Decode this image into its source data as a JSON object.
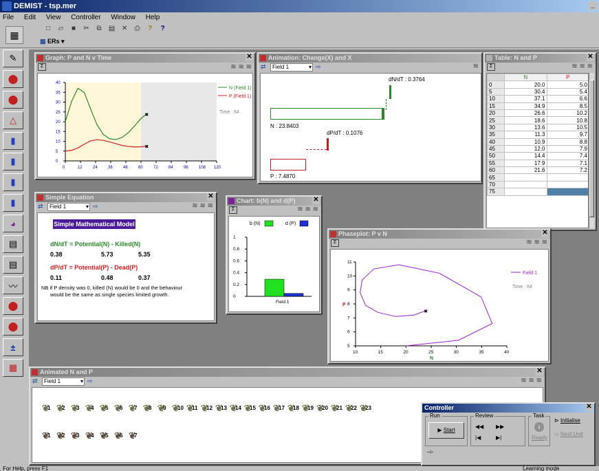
{
  "app": {
    "title": "DEMIST - tsp.mer",
    "menu": [
      "File",
      "Edit",
      "View",
      "Controller",
      "Window",
      "Help"
    ],
    "ers_label": "ERs",
    "status_left": "For Help, press F1",
    "status_right": "Learning mode"
  },
  "graph": {
    "title": "Graph: P and N v Time",
    "legend": [
      "N (Field 1)",
      "P (Field 1)"
    ],
    "time_label": "Time : 64",
    "xticks": [
      "0",
      "12",
      "24",
      "36",
      "48",
      "60",
      "72",
      "84",
      "96",
      "108",
      "120"
    ],
    "yticks": [
      "0",
      "5",
      "10",
      "15",
      "20",
      "25",
      "30",
      "35",
      "40"
    ]
  },
  "animation": {
    "title": "Animation: Change(X) and X",
    "field": "Field 1",
    "dndt": "dN/dT : 0.3764",
    "n": "N : 23.8403",
    "dpdt": "dP/dT : 0.1076",
    "p": "P : 7.4870"
  },
  "table": {
    "title": "Table: N and P",
    "headers": [
      "N",
      "P"
    ],
    "rows": [
      [
        "0",
        "20.0",
        "5.0"
      ],
      [
        "5",
        "30.4",
        "5.4"
      ],
      [
        "10",
        "37.1",
        "6.6"
      ],
      [
        "15",
        "34.9",
        "8.5"
      ],
      [
        "20",
        "26.6",
        "10.2"
      ],
      [
        "25",
        "18.6",
        "10.8"
      ],
      [
        "30",
        "13.6",
        "10.5"
      ],
      [
        "35",
        "11.3",
        "9.7"
      ],
      [
        "40",
        "10.9",
        "8.8"
      ],
      [
        "45",
        "12.0",
        "7.9"
      ],
      [
        "50",
        "14.4",
        "7.4"
      ],
      [
        "55",
        "17.9",
        "7.1"
      ],
      [
        "60",
        "21.6",
        "7.2"
      ],
      [
        "65",
        "",
        ""
      ],
      [
        "70",
        "",
        ""
      ],
      [
        "75",
        "",
        ""
      ]
    ]
  },
  "equation": {
    "title": "Simple Equation",
    "field": "Field 1",
    "model_title": "Simple Mathematical Model",
    "eq1": "dN/dT  =  Potential(N) - Killed(N)",
    "eq1_vals": [
      "0.38",
      "5.73",
      "5.35"
    ],
    "eq2": "dP/dT  =  Potential(P) - Dead(P)",
    "eq2_vals": [
      "0.11",
      "0.48",
      "0.37"
    ],
    "note1": "NB if P density was 0, killed (N) would be 0 and the behaviour",
    "note2": "would be the same as single species limited growth."
  },
  "barchart": {
    "title": "Chart: b(N) and d(P)",
    "legend": [
      "b (N)",
      "d (P)"
    ],
    "yticks": [
      "0",
      "0.2",
      "0.4",
      "0.6",
      "0.8",
      "1"
    ],
    "category": "Field 1"
  },
  "phaseplot": {
    "title": "Phaseplot: P v N",
    "legend": "Field 1",
    "time_label": "Time : 64",
    "xticks": [
      "10",
      "15",
      "20",
      "25",
      "30",
      "35",
      "40"
    ],
    "yticks": [
      "5",
      "6",
      "7",
      "8",
      "9",
      "10",
      "11"
    ],
    "xlabel": "N",
    "ylabel": "P"
  },
  "animated": {
    "title": "Animated N and P",
    "field": "Field 1",
    "row1": [
      "1",
      "2",
      "3",
      "4",
      "5",
      "6",
      "7",
      "8",
      "9",
      "10",
      "11",
      "12",
      "13",
      "14",
      "15",
      "16",
      "17",
      "18",
      "19",
      "20",
      "21",
      "22",
      "23"
    ],
    "row2": [
      "1",
      "2",
      "3",
      "4",
      "5",
      "6",
      "7"
    ]
  },
  "controller": {
    "title": "Controller",
    "run": "Run",
    "start": "Start",
    "review": "Review",
    "task": "Task",
    "ready": "Ready",
    "initialise": "Initialise",
    "next_unit": "Next Unit"
  },
  "chart_data": [
    {
      "type": "line",
      "title": "Graph: P and N v Time",
      "x": [
        0,
        5,
        10,
        15,
        20,
        25,
        30,
        35,
        40,
        45,
        50,
        55,
        60,
        64
      ],
      "series": [
        {
          "name": "N (Field 1)",
          "values": [
            20.0,
            30.4,
            37.1,
            34.9,
            26.6,
            18.6,
            13.6,
            11.3,
            10.9,
            12.0,
            14.4,
            17.9,
            21.6,
            23.8
          ]
        },
        {
          "name": "P (Field 1)",
          "values": [
            5.0,
            5.4,
            6.6,
            8.5,
            10.2,
            10.8,
            10.5,
            9.7,
            8.8,
            7.9,
            7.4,
            7.1,
            7.2,
            7.5
          ]
        }
      ],
      "xlim": [
        0,
        120
      ],
      "ylim": [
        0,
        40
      ]
    },
    {
      "type": "bar",
      "title": "Chart: b(N) and d(P)",
      "categories": [
        "Field 1"
      ],
      "series": [
        {
          "name": "b (N)",
          "values": [
            0.29
          ]
        },
        {
          "name": "d (P)",
          "values": [
            0.05
          ]
        }
      ],
      "ylim": [
        0,
        1
      ]
    },
    {
      "type": "line",
      "title": "Phaseplot: P v N",
      "series": [
        {
          "name": "Field 1",
          "x": [
            23.8,
            21.6,
            17.9,
            14.4,
            12.0,
            10.9,
            11.3,
            13.6,
            18.6,
            26.6,
            34.9,
            37.1,
            30.4,
            20.0
          ],
          "y": [
            7.5,
            7.2,
            7.1,
            7.4,
            7.9,
            8.8,
            9.7,
            10.5,
            10.8,
            10.2,
            8.5,
            6.6,
            5.4,
            5.0
          ]
        }
      ],
      "xlim": [
        10,
        40
      ],
      "ylim": [
        5,
        11
      ],
      "xlabel": "N",
      "ylabel": "P"
    }
  ]
}
